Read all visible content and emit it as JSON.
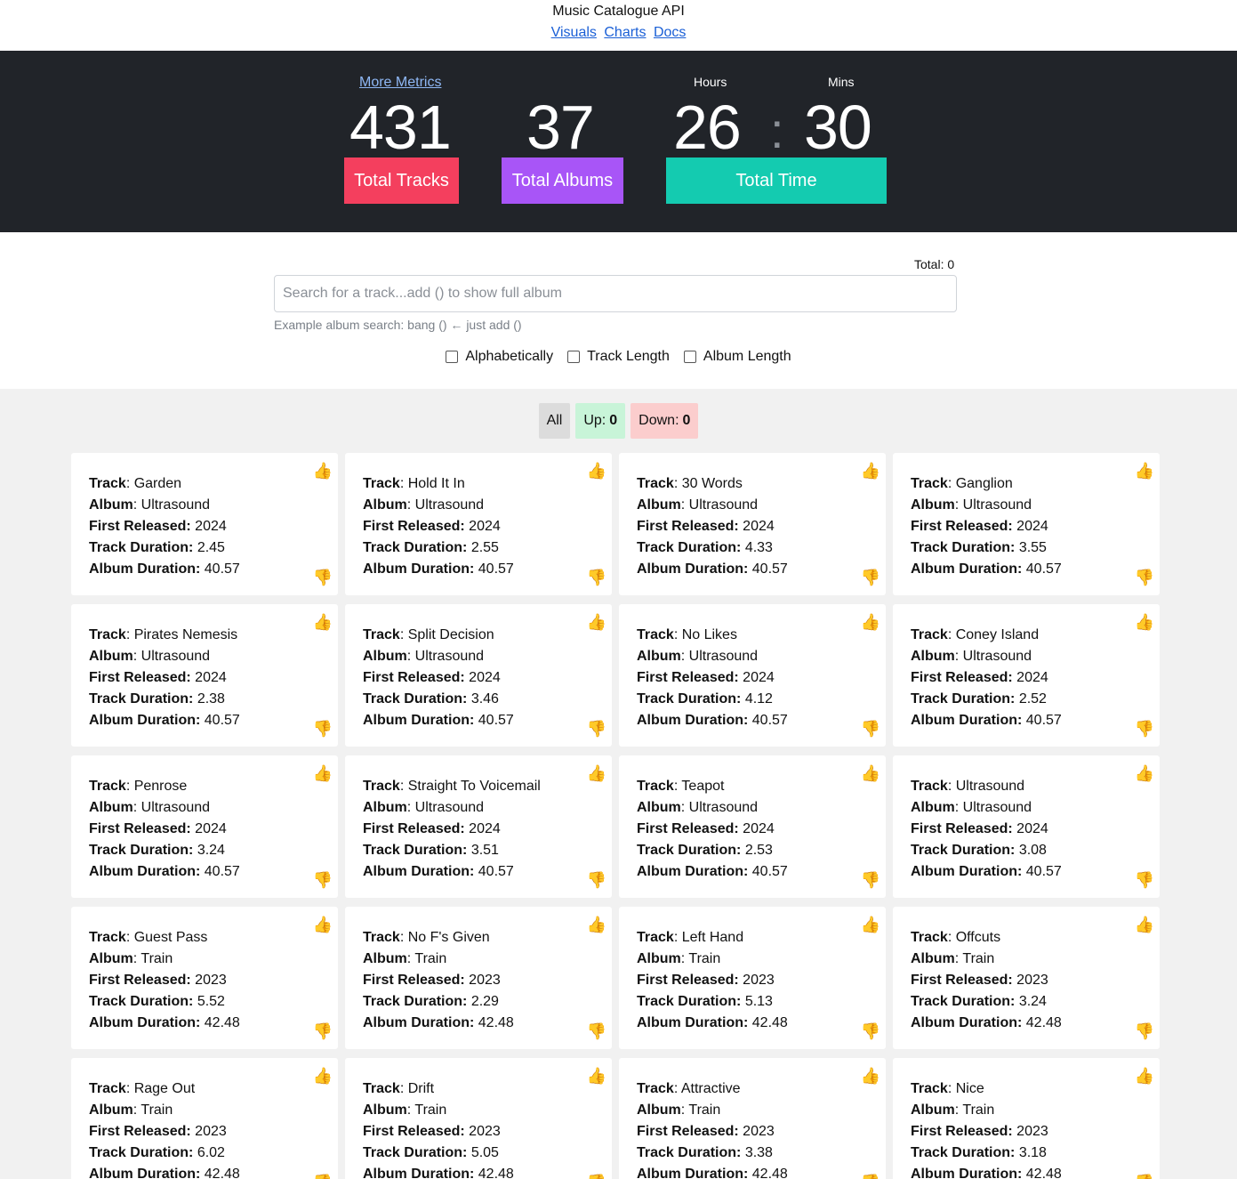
{
  "header": {
    "title": "Music Catalogue API",
    "links": [
      "Visuals",
      "Charts",
      "Docs"
    ]
  },
  "metrics": {
    "more_metrics": "More Metrics",
    "total_tracks": "431",
    "total_tracks_label": "Total Tracks",
    "total_albums": "37",
    "total_albums_label": "Total Albums",
    "hours_label": "Hours",
    "mins_label": "Mins",
    "hours": "26",
    "mins": "30",
    "colon": ":",
    "total_time_label": "Total Time",
    "colors": {
      "tracks": "#f43f5e",
      "albums": "#a855f7",
      "time": "#14cbb0"
    }
  },
  "search": {
    "total": "Total: 0",
    "placeholder": "Search for a track...add () to show full album",
    "help": "Example album search: bang () ← just add ()",
    "sort_options": [
      "Alphabetically",
      "Track Length",
      "Album Length"
    ]
  },
  "filters": {
    "all": "All",
    "up_label": "Up:",
    "up_count": "0",
    "down_label": "Down:",
    "down_count": "0"
  },
  "labels": {
    "track": "Track",
    "album": "Album",
    "first_released": "First Released:",
    "track_duration": "Track Duration:",
    "album_duration": "Album Duration:",
    "thumb_up": "👍",
    "thumb_down": "👎"
  },
  "tracks": [
    {
      "track": "Garden",
      "album": "Ultrasound",
      "released": "2024",
      "track_duration": "2.45",
      "album_duration": "40.57"
    },
    {
      "track": "Hold It In",
      "album": "Ultrasound",
      "released": "2024",
      "track_duration": "2.55",
      "album_duration": "40.57"
    },
    {
      "track": "30 Words",
      "album": "Ultrasound",
      "released": "2024",
      "track_duration": "4.33",
      "album_duration": "40.57"
    },
    {
      "track": "Ganglion",
      "album": "Ultrasound",
      "released": "2024",
      "track_duration": "3.55",
      "album_duration": "40.57"
    },
    {
      "track": "Pirates Nemesis",
      "album": "Ultrasound",
      "released": "2024",
      "track_duration": "2.38",
      "album_duration": "40.57"
    },
    {
      "track": "Split Decision",
      "album": "Ultrasound",
      "released": "2024",
      "track_duration": "3.46",
      "album_duration": "40.57"
    },
    {
      "track": "No Likes",
      "album": "Ultrasound",
      "released": "2024",
      "track_duration": "4.12",
      "album_duration": "40.57"
    },
    {
      "track": "Coney Island",
      "album": "Ultrasound",
      "released": "2024",
      "track_duration": "2.52",
      "album_duration": "40.57"
    },
    {
      "track": "Penrose",
      "album": "Ultrasound",
      "released": "2024",
      "track_duration": "3.24",
      "album_duration": "40.57"
    },
    {
      "track": "Straight To Voicemail",
      "album": "Ultrasound",
      "released": "2024",
      "track_duration": "3.51",
      "album_duration": "40.57"
    },
    {
      "track": "Teapot",
      "album": "Ultrasound",
      "released": "2024",
      "track_duration": "2.53",
      "album_duration": "40.57"
    },
    {
      "track": "Ultrasound",
      "album": "Ultrasound",
      "released": "2024",
      "track_duration": "3.08",
      "album_duration": "40.57"
    },
    {
      "track": "Guest Pass",
      "album": "Train",
      "released": "2023",
      "track_duration": "5.52",
      "album_duration": "42.48"
    },
    {
      "track": "No F's Given",
      "album": "Train",
      "released": "2023",
      "track_duration": "2.29",
      "album_duration": "42.48"
    },
    {
      "track": "Left Hand",
      "album": "Train",
      "released": "2023",
      "track_duration": "5.13",
      "album_duration": "42.48"
    },
    {
      "track": "Offcuts",
      "album": "Train",
      "released": "2023",
      "track_duration": "3.24",
      "album_duration": "42.48"
    },
    {
      "track": "Rage Out",
      "album": "Train",
      "released": "2023",
      "track_duration": "6.02",
      "album_duration": "42.48"
    },
    {
      "track": "Drift",
      "album": "Train",
      "released": "2023",
      "track_duration": "5.05",
      "album_duration": "42.48"
    },
    {
      "track": "Attractive",
      "album": "Train",
      "released": "2023",
      "track_duration": "3.38",
      "album_duration": "42.48"
    },
    {
      "track": "Nice",
      "album": "Train",
      "released": "2023",
      "track_duration": "3.18",
      "album_duration": "42.48"
    }
  ]
}
